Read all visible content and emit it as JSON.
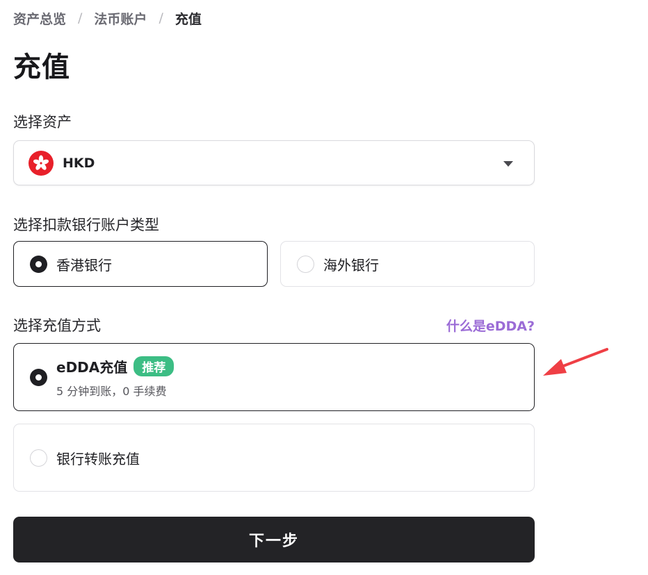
{
  "breadcrumb": {
    "items": [
      "资产总览",
      "法币账户",
      "充值"
    ],
    "separator": "/"
  },
  "page": {
    "title": "充值"
  },
  "asset_select": {
    "label": "选择资产",
    "value": "HKD",
    "flag_icon": "hong-kong-flag-icon"
  },
  "bank_type": {
    "label": "选择扣款银行账户类型",
    "options": [
      {
        "label": "香港银行",
        "selected": true
      },
      {
        "label": "海外银行",
        "selected": false
      }
    ]
  },
  "deposit_method": {
    "label": "选择充值方式",
    "help_link": "什么是eDDA?",
    "options": [
      {
        "title": "eDDA充值",
        "badge": "推荐",
        "subtitle": "5 分钟到账，0 手续费",
        "selected": true
      },
      {
        "title": "银行转账充值",
        "selected": false
      }
    ]
  },
  "actions": {
    "next_label": "下一步"
  },
  "colors": {
    "primary_dark": "#232326",
    "badge_green": "#3cbd84",
    "link_purple": "#9b6cd6",
    "annotation_arrow": "#ef3f45"
  }
}
